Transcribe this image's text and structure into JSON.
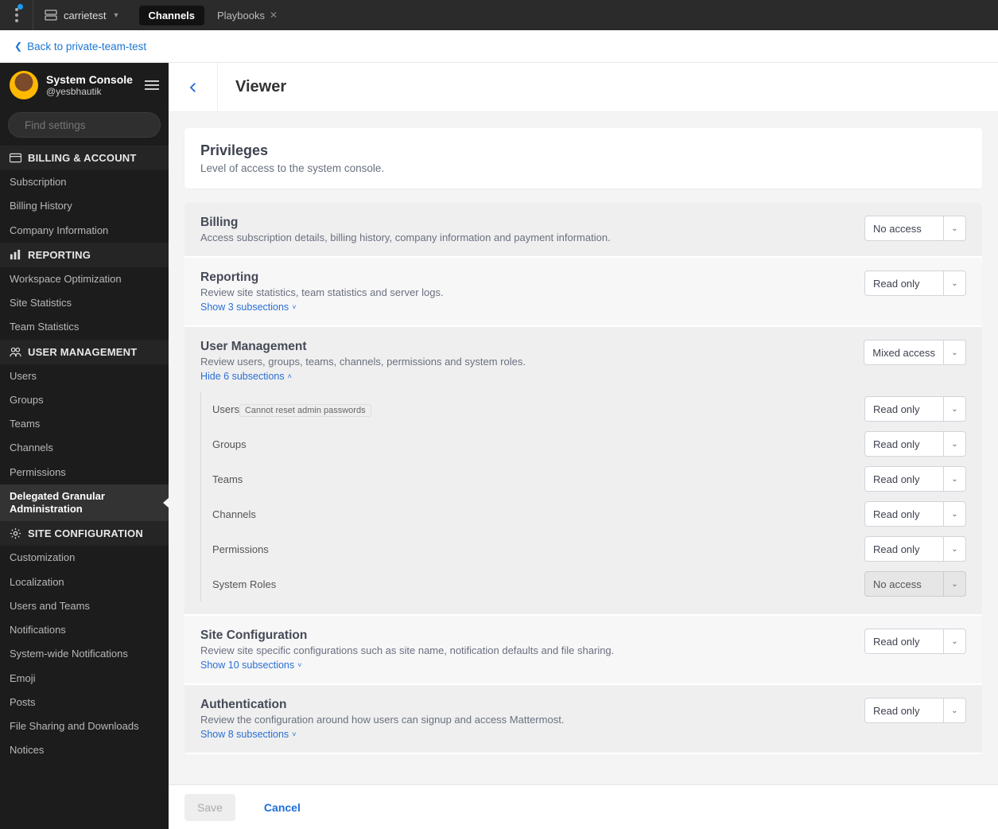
{
  "topbar": {
    "server_name": "carrietest",
    "tabs": [
      {
        "label": "Channels",
        "active": true,
        "closable": false
      },
      {
        "label": "Playbooks",
        "active": false,
        "closable": true
      }
    ]
  },
  "backbar": {
    "label": "Back to private-team-test"
  },
  "sidebar": {
    "title": "System Console",
    "subtitle": "@yesbhautik",
    "search_placeholder": "Find settings",
    "sections": [
      {
        "heading": "BILLING & ACCOUNT",
        "icon": "card",
        "items": [
          {
            "label": "Subscription"
          },
          {
            "label": "Billing History"
          },
          {
            "label": "Company Information"
          }
        ]
      },
      {
        "heading": "REPORTING",
        "icon": "chart",
        "items": [
          {
            "label": "Workspace Optimization"
          },
          {
            "label": "Site Statistics"
          },
          {
            "label": "Team Statistics"
          }
        ]
      },
      {
        "heading": "USER MANAGEMENT",
        "icon": "users",
        "items": [
          {
            "label": "Users"
          },
          {
            "label": "Groups"
          },
          {
            "label": "Teams"
          },
          {
            "label": "Channels"
          },
          {
            "label": "Permissions"
          },
          {
            "label": "Delegated Granular Administration",
            "active": true
          }
        ]
      },
      {
        "heading": "SITE CONFIGURATION",
        "icon": "gear",
        "items": [
          {
            "label": "Customization"
          },
          {
            "label": "Localization"
          },
          {
            "label": "Users and Teams"
          },
          {
            "label": "Notifications"
          },
          {
            "label": "System-wide Notifications"
          },
          {
            "label": "Emoji"
          },
          {
            "label": "Posts"
          },
          {
            "label": "File Sharing and Downloads"
          },
          {
            "label": "Notices"
          }
        ]
      }
    ]
  },
  "page": {
    "title": "Viewer",
    "privileges_heading": "Privileges",
    "privileges_sub": "Level of access to the system console.",
    "sections": [
      {
        "title": "Billing",
        "desc": "Access subscription details, billing history, company information and payment information.",
        "access": "No access",
        "bg": "dark"
      },
      {
        "title": "Reporting",
        "desc": "Review site statistics, team statistics and server logs.",
        "access": "Read only",
        "toggle": "Show 3 subsections",
        "toggle_dir": "down",
        "bg": "light"
      },
      {
        "title": "User Management",
        "desc": "Review users, groups, teams, channels, permissions and system roles.",
        "access": "Mixed access",
        "toggle": "Hide 6 subsections",
        "toggle_dir": "up",
        "bg": "dark",
        "subs": [
          {
            "name": "Users",
            "badge": "Cannot reset admin passwords",
            "access": "Read only"
          },
          {
            "name": "Groups",
            "access": "Read only"
          },
          {
            "name": "Teams",
            "access": "Read only"
          },
          {
            "name": "Channels",
            "access": "Read only"
          },
          {
            "name": "Permissions",
            "access": "Read only"
          },
          {
            "name": "System Roles",
            "access": "No access",
            "disabled": true
          }
        ]
      },
      {
        "title": "Site Configuration",
        "desc": "Review site specific configurations such as site name, notification defaults and file sharing.",
        "access": "Read only",
        "toggle": "Show 10 subsections",
        "toggle_dir": "down",
        "bg": "light"
      },
      {
        "title": "Authentication",
        "desc": "Review the configuration around how users can signup and access Mattermost.",
        "access": "Read only",
        "toggle": "Show 8 subsections",
        "toggle_dir": "down",
        "bg": "dark"
      }
    ],
    "footer": {
      "save": "Save",
      "cancel": "Cancel"
    }
  }
}
